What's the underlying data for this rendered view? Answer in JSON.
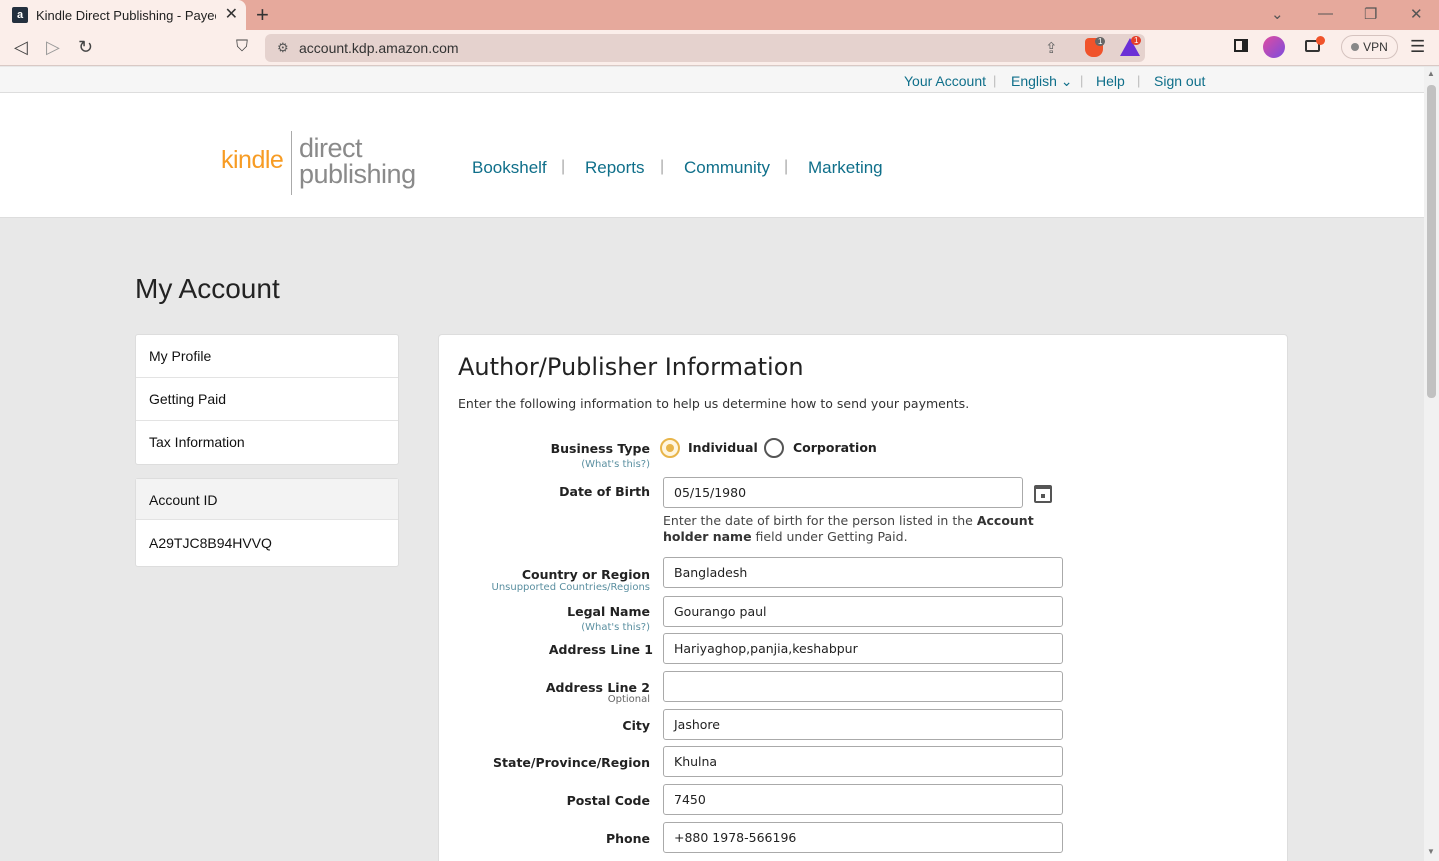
{
  "browser": {
    "tab_title": "Kindle Direct Publishing - Payee",
    "url": "account.kdp.amazon.com",
    "vpn_label": "VPN",
    "brave_badge": "1",
    "rewards_badge": "1"
  },
  "utility_nav": {
    "your_account": "Your Account",
    "language": "English ⌄",
    "help": "Help",
    "sign_out": "Sign out"
  },
  "logo": {
    "kindle": "kindle",
    "direct": "direct",
    "publishing": "publishing"
  },
  "main_nav": {
    "bookshelf": "Bookshelf",
    "reports": "Reports",
    "community": "Community",
    "marketing": "Marketing"
  },
  "page_title": "My Account",
  "sidebar": {
    "items": [
      {
        "label": "My Profile"
      },
      {
        "label": "Getting Paid"
      },
      {
        "label": "Tax Information"
      }
    ],
    "account_id_label": "Account ID",
    "account_id_value": "A29TJC8B94HVVQ"
  },
  "form": {
    "title": "Author/Publisher Information",
    "description": "Enter the following information to help us determine how to send your payments.",
    "business_type": {
      "label": "Business Type",
      "help": "(What's this?)",
      "options": [
        {
          "label": "Individual",
          "selected": true
        },
        {
          "label": "Corporation",
          "selected": false
        }
      ]
    },
    "date_of_birth": {
      "label": "Date of Birth",
      "value": "05/15/1980",
      "hint_prefix": "Enter the date of birth for the person listed in the ",
      "hint_bold": "Account holder name",
      "hint_suffix": " field under Getting Paid."
    },
    "country": {
      "label": "Country or Region",
      "help": "Unsupported Countries/Regions",
      "value": "Bangladesh"
    },
    "legal_name": {
      "label": "Legal Name",
      "help": "(What's this?)",
      "value": "Gourango paul"
    },
    "address1": {
      "label": "Address Line 1",
      "value": "Hariyaghop,panjia,keshabpur"
    },
    "address2": {
      "label": "Address Line 2",
      "optional": "Optional",
      "value": ""
    },
    "city": {
      "label": "City",
      "value": "Jashore"
    },
    "state": {
      "label": "State/Province/Region",
      "value": "Khulna"
    },
    "postal_code": {
      "label": "Postal Code",
      "value": "7450"
    },
    "phone": {
      "label": "Phone",
      "value": "+880 1978-566196"
    }
  }
}
